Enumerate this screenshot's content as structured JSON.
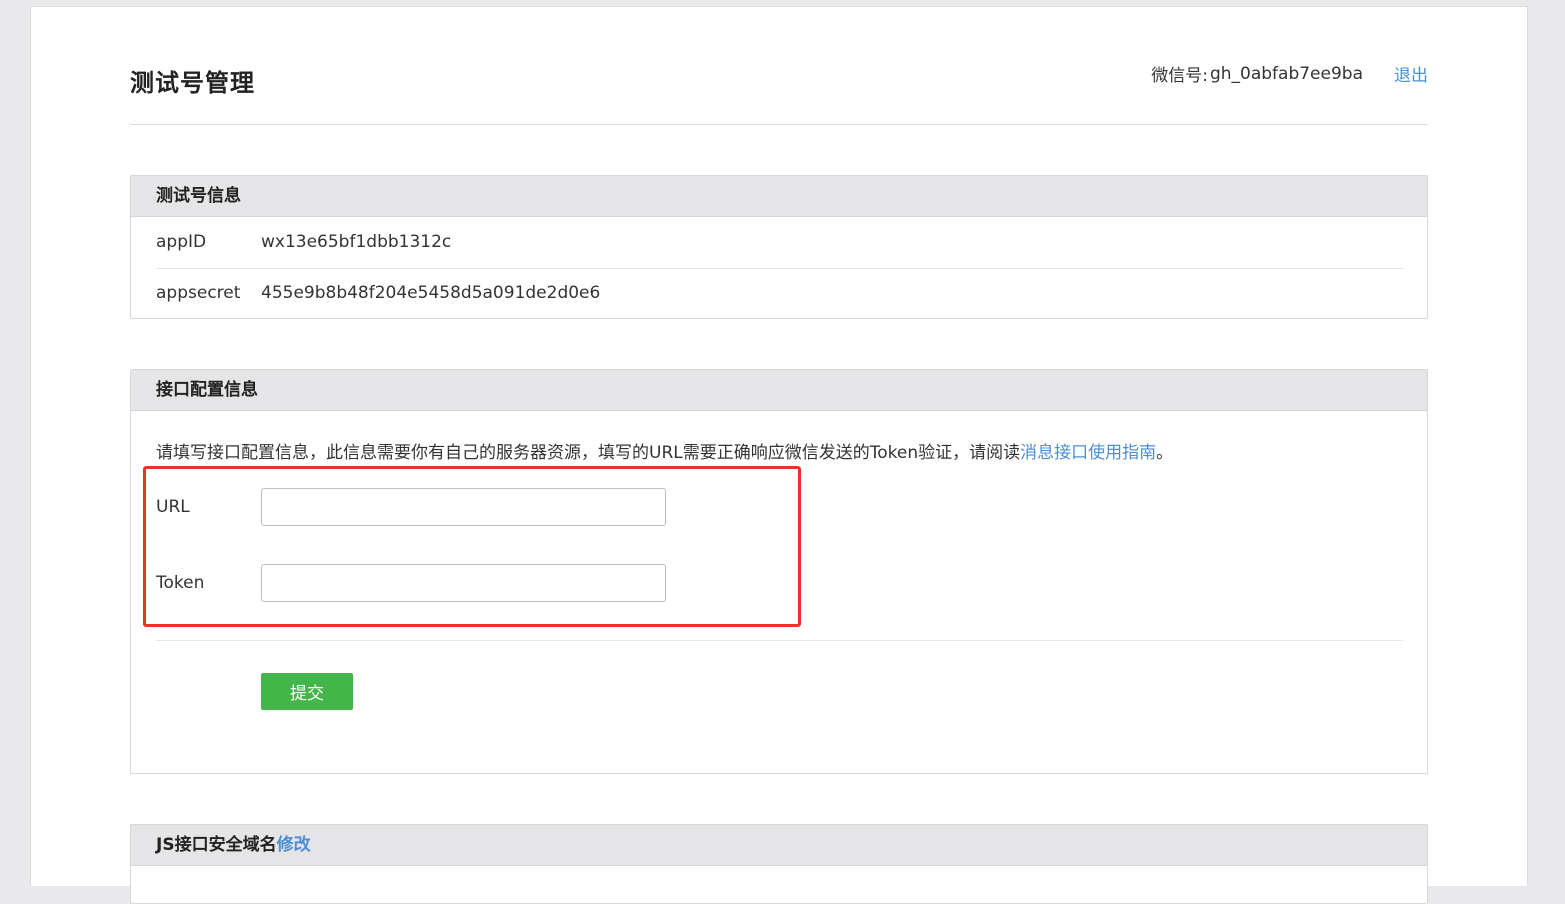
{
  "header": {
    "title": "测试号管理",
    "account_label": "微信号:",
    "account_value": "gh_0abfab7ee9ba",
    "logout": "退出"
  },
  "test_account_panel": {
    "title": "测试号信息",
    "rows": [
      {
        "key": "appID",
        "value": "wx13e65bf1dbb1312c"
      },
      {
        "key": "appsecret",
        "value": "455e9b8b48f204e5458d5a091de2d0e6"
      }
    ]
  },
  "config_panel": {
    "title": "接口配置信息",
    "description": "请填写接口配置信息，此信息需要你有自己的服务器资源，填写的URL需要正确响应微信发送的Token验证，请阅读",
    "guide_link": "消息接口使用指南",
    "description_end": "。",
    "url_label": "URL",
    "url_value": "",
    "token_label": "Token",
    "token_value": "",
    "submit_label": "提交",
    "highlight_color": "#e8352b"
  },
  "js_panel": {
    "title": "JS接口安全域名",
    "modify_link": "修改"
  },
  "colors": {
    "link": "#4b8fd6",
    "submit_bg": "#44b549",
    "panel_head_bg": "#e5e5e7"
  }
}
